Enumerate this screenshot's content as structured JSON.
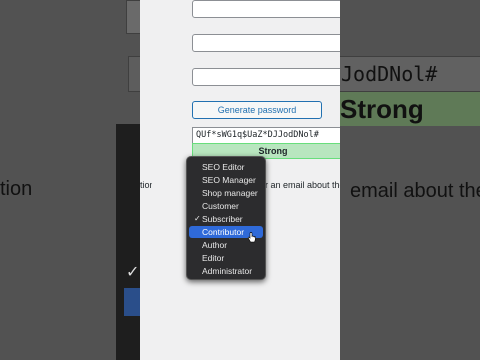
{
  "background": {
    "password_zoom": "JodDNol#",
    "strength_zoom": "Strong",
    "left_text_zoom": "tion",
    "right_text_zoom": "email about the"
  },
  "form": {
    "generate_button": "Generate password",
    "password_value": "QUf*sWG1q$UaZ*DJJodDNol#",
    "strength_label": "Strong",
    "left_label": "tion",
    "notify_text": "er an email about the"
  },
  "role_dropdown": {
    "options": [
      {
        "label": "SEO Editor"
      },
      {
        "label": "SEO Manager"
      },
      {
        "label": "Shop manager"
      },
      {
        "label": "Customer"
      },
      {
        "label": "Subscriber",
        "checked": true
      },
      {
        "label": "Contributor",
        "highlighted": true
      },
      {
        "label": "Author"
      },
      {
        "label": "Editor"
      },
      {
        "label": "Administrator"
      }
    ],
    "check_glyph": "✓",
    "highlight_color": "#2f6ad9"
  }
}
